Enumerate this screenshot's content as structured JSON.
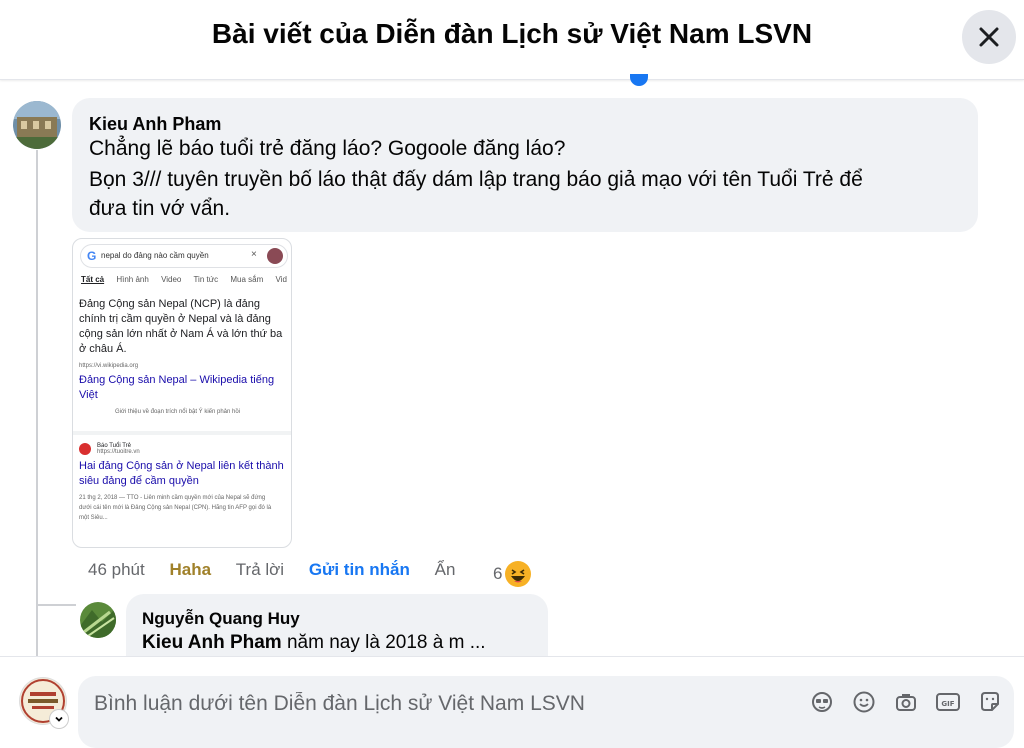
{
  "header": {
    "title": "Bài viết của Diễn đàn Lịch sử Việt Nam LSVN"
  },
  "comment": {
    "author": "Kieu Anh Pham",
    "lines": [
      "Chẳng lẽ báo tuổi trẻ đăng láo? Gogoole đăng láo?",
      "Bọn 3/// tuyên truyền bố láo thật đấy dám lập trang báo giả mạo với tên Tuổi Trẻ để",
      "đưa tin vớ vẩn."
    ],
    "attachment": {
      "search_query": "nepal do đảng nào cầm quyền",
      "tabs": [
        "Tất cả",
        "Hình ảnh",
        "Video",
        "Tin tức",
        "Mua sắm",
        "Vid"
      ],
      "snippet": "Đảng Cộng sản Nepal (NCP) là đảng chính trị cầm quyền ở Nepal và là đảng cộng sản lớn nhất ở Nam Á và lớn thứ ba ở châu Á.",
      "result1_url": "https://vi.wikipedia.org",
      "result1_title": "Đảng Cộng sản Nepal – Wikipedia tiếng Việt",
      "result1_meta": "Giới thiệu về đoạn trích nổi bật   Ý kiến phản hồi",
      "result2_source": "Báo Tuổi Trẻ",
      "result2_url": "https://tuoitre.vn",
      "result2_title": "Hai đảng Cộng sản ở Nepal liên kết thành siêu đảng để cầm quyền",
      "result2_desc": "21 thg 2, 2018 — TTO - Liên minh cầm quyền mới của Nepal sẽ đứng dưới cái tên mới là Đảng Cộng sản Nepal (CPN). Hãng tin AFP gọi đó là một Siêu..."
    },
    "actions": {
      "time": "46 phút",
      "reaction": "Haha",
      "reply": "Trả lời",
      "send": "Gửi tin nhắn",
      "hide": "Ẩn",
      "reaction_count": "6"
    }
  },
  "reply": {
    "author": "Nguyễn Quang Huy",
    "mention": "Kieu Anh Pham",
    "text": " năm nay là 2018 à m ..."
  },
  "composer": {
    "placeholder": "Bình luận dưới tên Diễn đàn Lịch sử Việt Nam LSVN",
    "tools": [
      "avatar-sticker-icon",
      "emoji-icon",
      "camera-icon",
      "gif-icon",
      "sticker-icon"
    ]
  },
  "colors": {
    "link": "#1877f2",
    "haha": "#a0812a",
    "bubble": "#f0f2f5"
  }
}
